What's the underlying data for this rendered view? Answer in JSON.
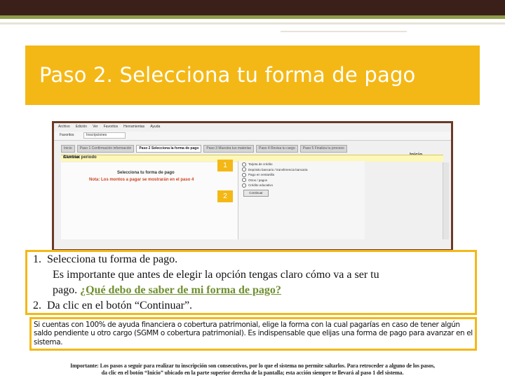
{
  "slide": {
    "title": "Paso 2. Selecciona tu forma de pago"
  },
  "screenshot": {
    "menu": [
      "Archivo",
      "Edición",
      "Ver",
      "Favoritos",
      "Herramientas",
      "Ayuda"
    ],
    "favorites_label": "Favoritos",
    "browser_tab": "Inscripciones",
    "steps": [
      "Inicio",
      "Paso 1 Confirmación información",
      "Paso 2 Selecciona la forma de pago",
      "Paso 3 Muestra tus materias",
      "Paso 4 Revisa tu cargo",
      "Paso 5 Finaliza tu proceso"
    ],
    "inicio_link": "Inicio",
    "alumno_label": "Alumno:",
    "cambiar_periodo": "Cambiar periodo",
    "select_title": "Selecciona tu forma de pago",
    "note_label": "Nota:",
    "note_text": "Los montos a pagar se mostrarán en el paso 4",
    "payment_options": [
      "Tarjeta de crédito",
      "Depósito bancario / transferencia bancaria",
      "Pago en ventanilla",
      "Otros / pagos",
      "Crédito educativo"
    ],
    "continue_button": "Continuar",
    "marker_1": "1",
    "marker_2": "2"
  },
  "instructions": {
    "item1_num": "1.",
    "item1_title": "Selecciona tu forma de pago.",
    "item1_body_line1": "Es importante que antes de elegir la opción tengas claro cómo va a ser tu",
    "item1_body_line2": "pago.",
    "item1_link": "¿Qué debo de saber de mi forma de pago?",
    "item2_num": "2.",
    "item2_text": "Da clic en el botón “Continuar”."
  },
  "note_box": {
    "text": "Si cuentas con 100% de ayuda financiera o cobertura patrimonial, elige la forma con la cual pagarías en caso de tener algún saldo pendiente u otro cargo (SGMM o cobertura patrimonial). Es indispensable que elijas una forma de pago para avanzar en el sistema."
  },
  "footer": {
    "line1": "Importante: Los pasos a seguir para realizar tu inscripción son consecutivos, por lo que el sistema no permite saltarlos. Para retroceder a alguno de los pasos,",
    "line2": "da clic en el botón “Inicio” ubicado en la parte superior derecha de la pantalla; esta acción siempre te llevará al paso 1 del sistema."
  },
  "colors": {
    "accent": "#f4b816",
    "topbar": "#3a2018",
    "link": "#6f8f2f",
    "note": "#cc4422"
  }
}
